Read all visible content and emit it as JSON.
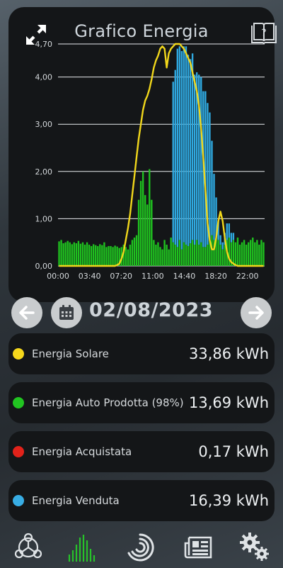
{
  "header": {
    "title": "Grafico Energia"
  },
  "icons": {
    "expand": "expand-arrows-icon",
    "guide": "book-help-icon",
    "calendar": "calendar-icon",
    "prev": "arrow-left-icon",
    "next": "arrow-right-icon"
  },
  "date": {
    "value": "02/08/2023"
  },
  "chart_data": {
    "type": "bar",
    "title": "",
    "xlabel": "",
    "ylabel": "",
    "ylim": [
      0,
      4.7
    ],
    "y_ticks": [
      "0,00",
      "1,00",
      "2,00",
      "3,00",
      "4,00",
      "4,70"
    ],
    "x_ticks": [
      "00:00",
      "03:40",
      "07:20",
      "11:00",
      "14:40",
      "18:20",
      "22:00"
    ],
    "interval_minutes": 15,
    "series": [
      {
        "name": "Energia Auto Prodotta",
        "color": "#1fc11f",
        "values": [
          0.52,
          0.55,
          0.48,
          0.5,
          0.53,
          0.5,
          0.46,
          0.5,
          0.48,
          0.53,
          0.47,
          0.5,
          0.45,
          0.5,
          0.45,
          0.42,
          0.46,
          0.44,
          0.42,
          0.46,
          0.44,
          0.5,
          0.4,
          0.42,
          0.42,
          0.4,
          0.43,
          0.41,
          0.38,
          0.4,
          0.45,
          0.4,
          0.35,
          0.45,
          0.55,
          0.6,
          0.65,
          1.4,
          1.8,
          2.0,
          1.5,
          1.3,
          2.05,
          1.4,
          0.55,
          0.45,
          0.5,
          0.4,
          0.35,
          0.55,
          0.45,
          0.35,
          0.6,
          0.5,
          0.45,
          0.4,
          0.55,
          0.35,
          0.5,
          0.45,
          0.42,
          0.48,
          0.55,
          0.45,
          0.55,
          0.45,
          0.5,
          0.4,
          0.4,
          0.45,
          0.55,
          0.65,
          0.55,
          0.6,
          0.55,
          0.45,
          0.35,
          0.45,
          0.55,
          0.6,
          0.5,
          0.55,
          0.5,
          0.6,
          0.45,
          0.5,
          0.55,
          0.45,
          0.5,
          0.55,
          0.6,
          0.5,
          0.55,
          0.45,
          0.55,
          0.5
        ]
      },
      {
        "name": "Energia Venduta",
        "color": "#2fa9e0",
        "values": [
          0,
          0,
          0,
          0,
          0,
          0,
          0,
          0,
          0,
          0,
          0,
          0,
          0,
          0,
          0,
          0,
          0,
          0,
          0,
          0,
          0,
          0,
          0,
          0,
          0,
          0,
          0,
          0,
          0,
          0,
          0,
          0,
          0,
          0,
          0,
          0,
          0,
          0,
          0,
          0,
          0,
          0,
          0,
          0,
          0,
          0,
          0,
          0,
          0,
          0,
          0,
          0,
          0,
          3.4,
          3.7,
          4.2,
          4.1,
          4.2,
          4.15,
          4.2,
          4.05,
          3.9,
          3.95,
          3.6,
          3.55,
          3.6,
          3.5,
          3.3,
          3.3,
          3.0,
          2.7,
          2.0,
          1.4,
          0.85,
          0.4,
          0.2,
          0.15,
          0.25,
          0.35,
          0.3,
          0.2,
          0.15,
          0,
          0,
          0,
          0,
          0,
          0,
          0,
          0,
          0,
          0,
          0,
          0,
          0,
          0
        ]
      },
      {
        "name": "Energia Acquistata",
        "color": "#e0281e",
        "total_kwh": "0,17"
      },
      {
        "name": "Energia Solare",
        "color": "#f1d71b",
        "type": "line",
        "values": [
          0,
          0,
          0,
          0,
          0,
          0,
          0,
          0,
          0,
          0,
          0,
          0,
          0,
          0,
          0,
          0,
          0,
          0,
          0,
          0,
          0,
          0,
          0,
          0,
          0,
          0,
          0,
          0.02,
          0.05,
          0.15,
          0.3,
          0.55,
          0.8,
          1.1,
          1.5,
          1.9,
          2.3,
          2.7,
          3.0,
          3.3,
          3.5,
          3.6,
          3.75,
          3.95,
          4.2,
          4.35,
          4.45,
          4.6,
          4.65,
          4.6,
          4.2,
          4.5,
          4.6,
          4.65,
          4.7,
          4.7,
          4.7,
          4.65,
          4.6,
          4.5,
          4.4,
          4.3,
          4.1,
          3.9,
          3.7,
          3.4,
          2.9,
          2.3,
          1.6,
          0.9,
          0.55,
          0.35,
          0.35,
          0.6,
          0.95,
          1.15,
          0.95,
          0.6,
          0.3,
          0.15,
          0.08,
          0.05,
          0.02,
          0,
          0,
          0,
          0,
          0,
          0,
          0,
          0,
          0,
          0,
          0,
          0,
          0
        ]
      }
    ]
  },
  "stats": [
    {
      "label": "Energia Solare",
      "value": "33,86 kWh",
      "color": "#f6d81c"
    },
    {
      "label": "Energia Auto Prodotta (98%)",
      "value": "13,69 kWh",
      "color": "#21c421"
    },
    {
      "label": "Energia Acquistata",
      "value": "0,17 kWh",
      "color": "#e2221a"
    },
    {
      "label": "Energia Venduta",
      "value": "16,39 kWh",
      "color": "#38ade4"
    }
  ],
  "nav": [
    {
      "name": "nav-overview",
      "icon": "energy-flow-icon",
      "active": false
    },
    {
      "name": "nav-chart",
      "icon": "bar-chart-icon",
      "active": true
    },
    {
      "name": "nav-production",
      "icon": "spiral-gauge-icon",
      "active": false
    },
    {
      "name": "nav-reports",
      "icon": "newspaper-icon",
      "active": false
    },
    {
      "name": "nav-settings",
      "icon": "gears-icon",
      "active": false
    }
  ]
}
